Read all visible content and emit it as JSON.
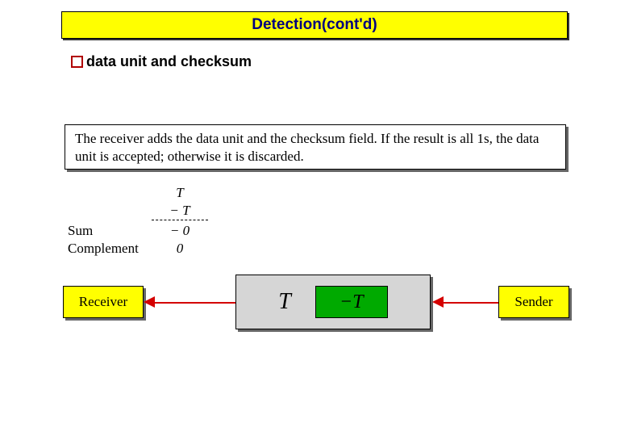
{
  "title": "Detection(cont'd)",
  "bullet": "data unit and checksum",
  "rule": "The receiver adds the data unit and the checksum field. If the result is all 1s, the data unit is accepted;  otherwise it is discarded.",
  "calc": {
    "row1": "T",
    "row2": "− T",
    "sumLabel": "Sum",
    "sumVal": "− 0",
    "compLabel": "Complement",
    "compVal": "0"
  },
  "diagram": {
    "receiver": "Receiver",
    "sender": "Sender",
    "packetT": "T",
    "packetNegT": "−T"
  }
}
